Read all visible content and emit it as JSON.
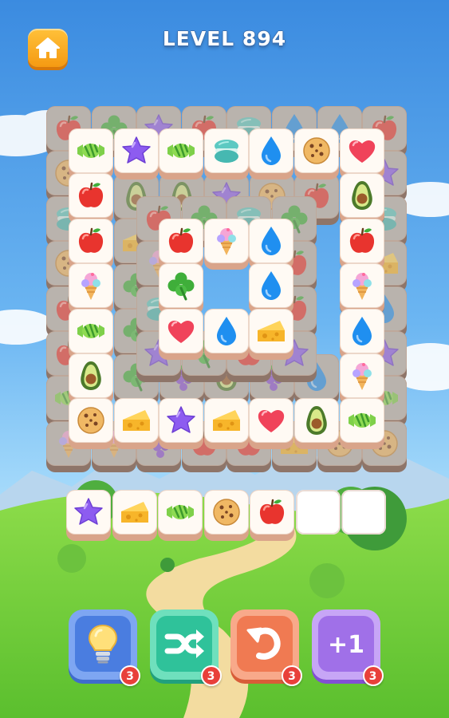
{
  "header": {
    "level_label": "LEVEL 894",
    "home_icon": "home-icon"
  },
  "board": {
    "layers": [
      {
        "name": "outer-layer",
        "tiles": [
          [
            "apple",
            "clover",
            "star",
            "apple",
            "macaron",
            "water-drop",
            "water-drop",
            "apple"
          ],
          [
            "cookie",
            "",
            "",
            "",
            "",
            "",
            "",
            "star"
          ],
          [
            "macaron",
            "",
            "",
            "",
            "",
            "",
            "",
            "macaron"
          ],
          [
            "cookie",
            "",
            "",
            "",
            "",
            "",
            "",
            "cheese"
          ],
          [
            "apple",
            "",
            "",
            "",
            "",
            "",
            "",
            "water-drop"
          ],
          [
            "apple",
            "",
            "",
            "",
            "",
            "",
            "",
            "star"
          ],
          [
            "candy",
            "",
            "",
            "",
            "",
            "",
            "",
            "candy"
          ],
          [
            "ice-cream",
            "ice-cream",
            "grapes",
            "apple",
            "apple",
            "cheese",
            "cookie",
            "cookie"
          ]
        ]
      },
      {
        "name": "inner-ring-back",
        "tiles": [
          [
            "avocado",
            "avocado",
            "star",
            "cookie",
            "apple",
            "grapes"
          ],
          [
            "cheese",
            "",
            "",
            "",
            "",
            "cheese"
          ],
          [
            "clover",
            "",
            "",
            "",
            "",
            "cookie"
          ],
          [
            "clover",
            "",
            "",
            "",
            "",
            "water-drop"
          ],
          [
            "clover",
            "grapes",
            "avocado",
            "grapes",
            "water-drop",
            "grapes"
          ]
        ]
      },
      {
        "name": "center-ring-lower",
        "tiles": [
          [
            "apple",
            "clover",
            "macaron",
            "clover"
          ],
          [
            "ice-cream",
            "",
            "",
            "apple"
          ],
          [
            "macaron",
            "",
            "",
            "apple"
          ],
          [
            "star",
            "clover",
            "apple",
            "star"
          ]
        ]
      },
      {
        "name": "frame-front",
        "top": [
          "candy",
          "star",
          "candy",
          "macaron",
          "water-drop",
          "cookie",
          "heart"
        ],
        "left": [
          "apple",
          "apple",
          "ice-cream",
          "candy",
          "avocado"
        ],
        "right": [
          "avocado",
          "apple",
          "ice-cream",
          "water-drop",
          "ice-cream"
        ],
        "bottom": [
          "cookie",
          "cheese",
          "star",
          "cheese",
          "heart",
          "avocado",
          "candy"
        ]
      },
      {
        "name": "center-front",
        "tiles": [
          [
            "apple",
            "ice-cream",
            "water-drop"
          ],
          [
            "clover",
            "",
            "water-drop"
          ],
          [
            "heart",
            "water-drop",
            "cheese"
          ]
        ]
      }
    ]
  },
  "tray": {
    "slots": [
      "star",
      "cheese",
      "candy",
      "cookie",
      "apple",
      "",
      ""
    ]
  },
  "boosters": [
    {
      "name": "hint",
      "icon": "lightbulb-icon",
      "count": "3",
      "color": "#4a7de0"
    },
    {
      "name": "shuffle",
      "icon": "shuffle-icon",
      "count": "3",
      "color": "#2fc29a"
    },
    {
      "name": "undo",
      "icon": "undo-icon",
      "count": "3",
      "color": "#f07a52"
    },
    {
      "name": "add-slot",
      "icon": "plus-one-icon",
      "count": "3",
      "color": "#a070e8",
      "label": "+1"
    }
  ]
}
